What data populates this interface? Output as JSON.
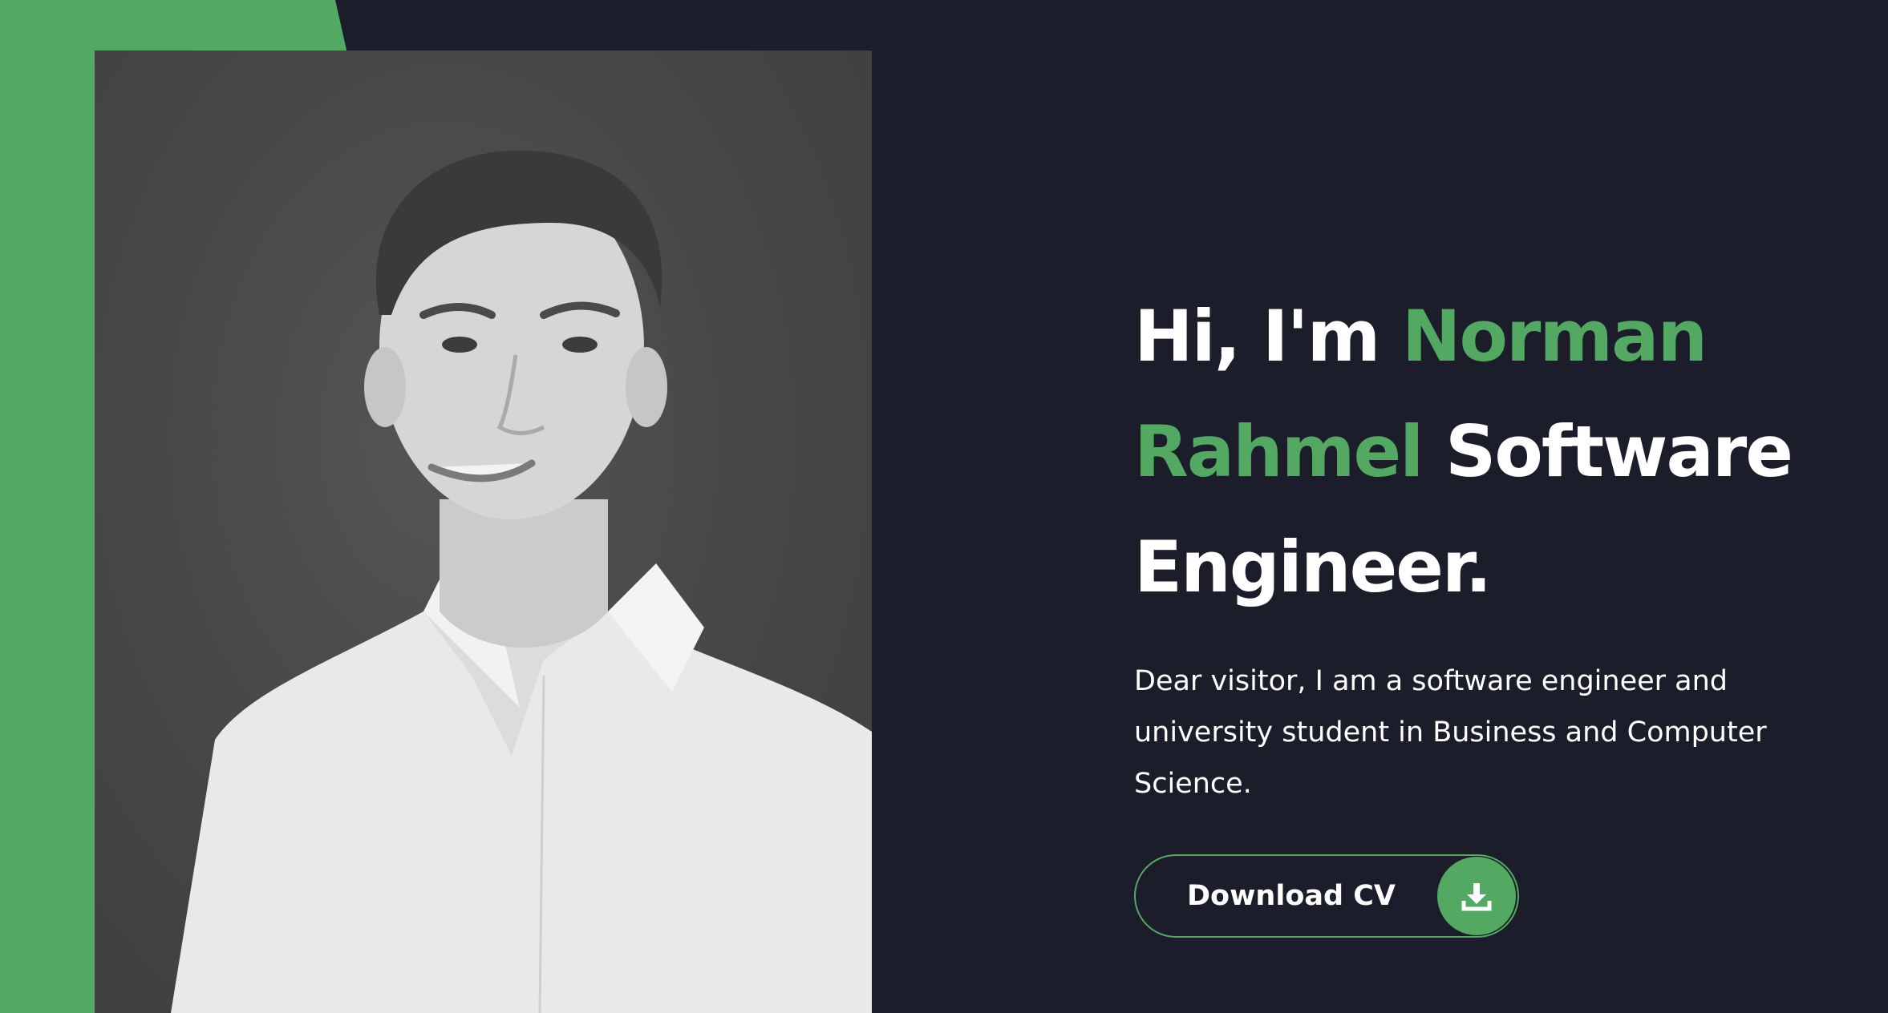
{
  "hero": {
    "greeting": "Hi, I'm",
    "name_first": "Norman",
    "name_last": "Rahmel",
    "role_line1": "Software",
    "role_line2": "Engineer.",
    "intro": "Dear visitor, I am a software engineer and university student in Business and Computer Science.",
    "cta_label": "Download CV",
    "cta_icon": "download-icon"
  },
  "portrait": {
    "subject": "portrait-photo"
  },
  "colors": {
    "background": "#1b1e2a",
    "accent": "#53a862",
    "text": "#ffffff"
  }
}
